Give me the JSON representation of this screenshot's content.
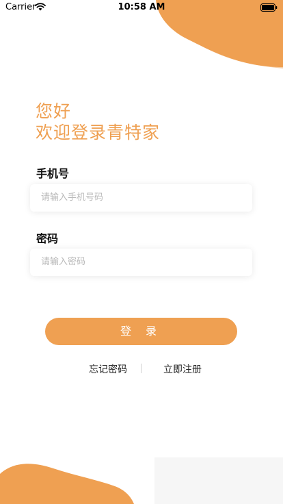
{
  "status_bar": {
    "carrier": "Carrier",
    "time": "10:58 AM"
  },
  "greeting": {
    "line1": "您好",
    "line2": "欢迎登录青特家"
  },
  "phone_field": {
    "label": "手机号",
    "placeholder": "请输入手机号码"
  },
  "password_field": {
    "label": "密码",
    "placeholder": "请输入密码"
  },
  "login_button": {
    "label": "登 录"
  },
  "links": {
    "forgot_password": "忘记密码",
    "register": "立即注册"
  },
  "colors": {
    "accent": "#efa052",
    "accent_light": "#f6c79c"
  },
  "icons": {
    "wifi": "wifi-icon",
    "battery": "battery-icon"
  }
}
